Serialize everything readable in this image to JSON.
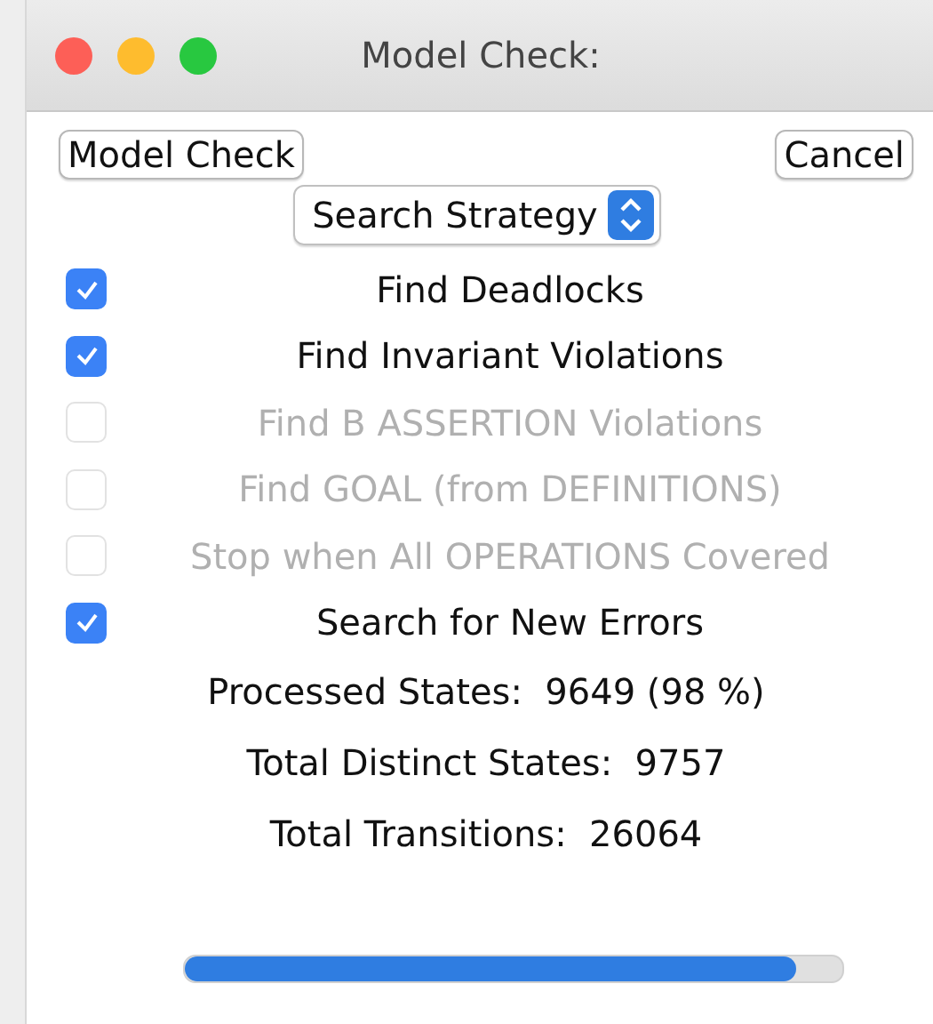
{
  "window": {
    "title": "Model Check:"
  },
  "buttons": {
    "primary": "Model Check",
    "cancel": "Cancel"
  },
  "strategy": {
    "label": "Search Strategy"
  },
  "options": [
    {
      "label": "Find Deadlocks",
      "checked": true,
      "disabled": false
    },
    {
      "label": "Find Invariant Violations",
      "checked": true,
      "disabled": false
    },
    {
      "label": "Find B ASSERTION Violations",
      "checked": false,
      "disabled": true
    },
    {
      "label": "Find GOAL (from DEFINITIONS)",
      "checked": false,
      "disabled": true
    },
    {
      "label": "Stop when All OPERATIONS Covered",
      "checked": false,
      "disabled": true
    },
    {
      "label": "Search for New Errors",
      "checked": true,
      "disabled": false
    }
  ],
  "stats": [
    "Processed States:  9649 (98 %)",
    "Total Distinct States:  9757",
    "Total Transitions:  26064"
  ],
  "progress": {
    "level": 0.93
  }
}
